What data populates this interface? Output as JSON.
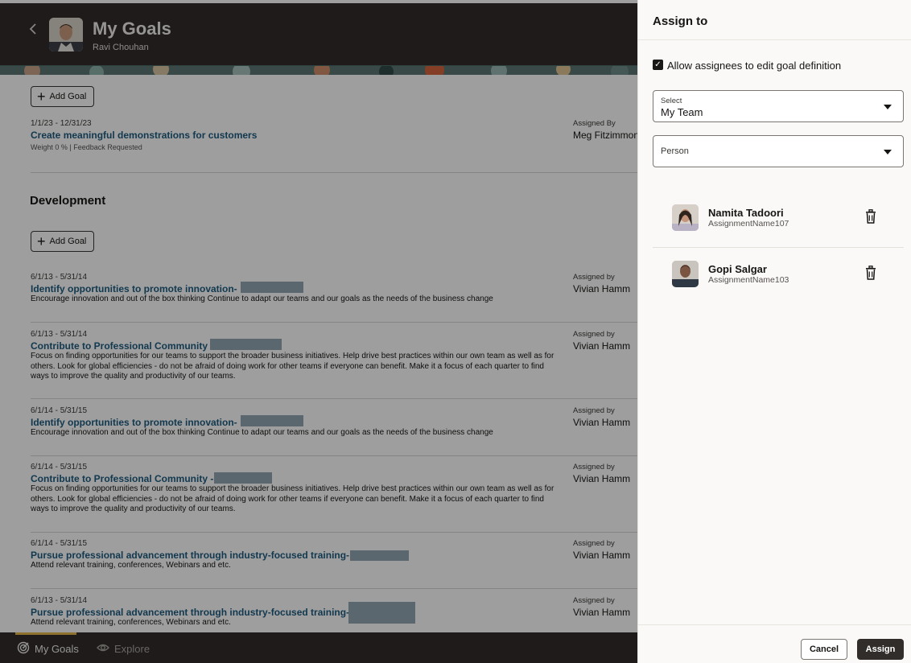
{
  "header": {
    "title": "My Goals",
    "subtitle": "Ravi Chouhan",
    "back_icon": "chevron-left-icon"
  },
  "content": {
    "add_goal_label": "Add Goal",
    "top_goal": {
      "dates": "1/1/23 - 12/31/23",
      "title": "Create meaningful demonstrations for customers",
      "meta": "Weight 0 % | Feedback Requested",
      "assigned_label": "Assigned By",
      "assigned_name": "Meg Fitzimmons"
    },
    "section_title": "Development",
    "dev_goals": [
      {
        "dates": "6/1/13 - 5/31/14",
        "title": "Identify opportunities to promote innovation-",
        "desc": "Encourage innovation and out of the box thinking Continue to adapt our teams and our goals as the needs of the business change",
        "assigned_label": "Assigned by",
        "assigned_name": "Vivian Hamm"
      },
      {
        "dates": "6/1/13 - 5/31/14",
        "title": "Contribute to Professional Community",
        "desc": "Focus on finding opportunities for our teams to support the broader business initiatives. Help drive best practices within our own team as well as for others. Look for global efficiencies - do not be afraid of doing work for other teams if everyone can benefit. Make it a focus of each quarter to find ways to improve the quality and productivity of our teams.",
        "assigned_label": "Assigned by",
        "assigned_name": "Vivian Hamm"
      },
      {
        "dates": "6/1/14 - 5/31/15",
        "title": "Identify opportunities to promote innovation-",
        "desc": "Encourage innovation and out of the box thinking Continue to adapt our teams and our goals as the needs of the business change",
        "assigned_label": "Assigned by",
        "assigned_name": "Vivian Hamm"
      },
      {
        "dates": "6/1/14 - 5/31/15",
        "title": "Contribute to Professional Community -",
        "desc": "Focus on finding opportunities for our teams to support the broader business initiatives. Help drive best practices within our own team as well as for others. Look for global efficiencies - do not be afraid of doing work for other teams if everyone can benefit. Make it a focus of each quarter to find ways to improve the quality and productivity of our teams.",
        "assigned_label": "Assigned by",
        "assigned_name": "Vivian Hamm"
      },
      {
        "dates": "6/1/14 - 5/31/15",
        "title": "Pursue professional advancement through industry-focused training-",
        "desc": "Attend relevant training, conferences, Webinars and etc.",
        "assigned_label": "Assigned by",
        "assigned_name": "Vivian Hamm"
      },
      {
        "dates": "6/1/13 - 5/31/14",
        "title": "Pursue professional advancement through industry-focused training-",
        "desc": "Attend relevant training, conferences, Webinars and etc.",
        "assigned_label": "Assigned by",
        "assigned_name": "Vivian Hamm"
      }
    ]
  },
  "bottom_nav": {
    "items": [
      {
        "label": "My Goals",
        "icon": "target-icon",
        "active": true
      },
      {
        "label": "Explore",
        "icon": "eye-icon",
        "active": false
      }
    ]
  },
  "drawer": {
    "title": "Assign to",
    "checkbox_label": "Allow assignees to edit goal definition",
    "checkbox_checked": true,
    "select": {
      "label": "Select",
      "value": "My Team"
    },
    "person": {
      "placeholder": "Person"
    },
    "assignees": [
      {
        "name": "Namita Tadoori",
        "assignment": "AssignmentName107"
      },
      {
        "name": "Gopi Salgar",
        "assignment": "AssignmentName103"
      }
    ],
    "cancel_label": "Cancel",
    "assign_label": "Assign"
  },
  "colors": {
    "header_bg": "#312d2a",
    "link": "#1e5c80",
    "nav_active": "#e7b94a"
  }
}
